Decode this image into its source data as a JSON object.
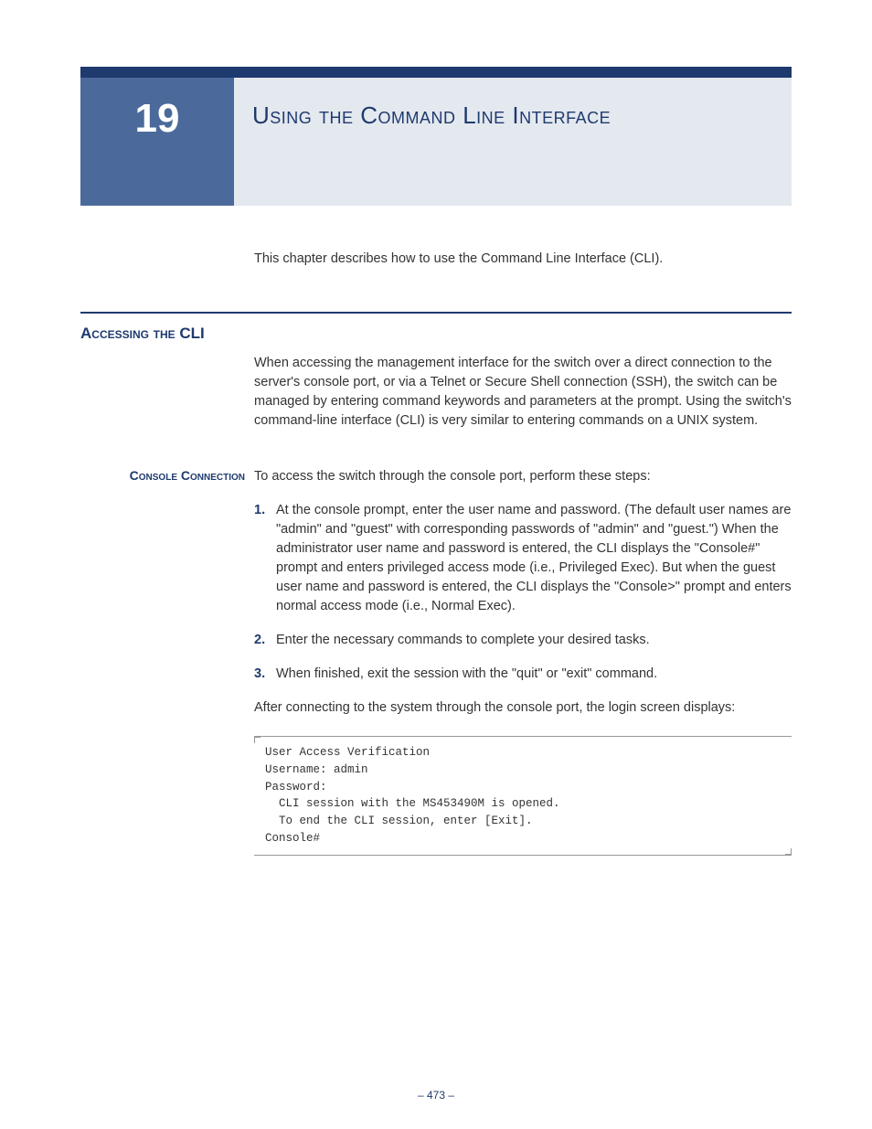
{
  "chapter": {
    "number": "19",
    "title": "Using the Command Line Interface"
  },
  "intro": "This chapter describes how to use the Command Line Interface (CLI).",
  "section1": {
    "heading": "Accessing the CLI",
    "body": "When accessing the management interface for the switch over a direct connection to the server's console port, or via a Telnet or Secure Shell connection (SSH), the switch can be managed by entering command keywords and parameters at the prompt. Using the switch's command-line interface (CLI) is very similar to entering commands on a UNIX system."
  },
  "subsection1": {
    "label": "Console Connection",
    "intro": "To access the switch through the console port, perform these steps:",
    "steps": [
      "At the console prompt, enter the user name and password. (The default user names are \"admin\" and \"guest\" with corresponding passwords of \"admin\" and \"guest.\") When the administrator user name and password is entered, the CLI displays the \"Console#\" prompt and enters privileged access mode (i.e., Privileged Exec). But when the guest user name and password is entered, the CLI displays the \"Console>\" prompt and enters normal access mode (i.e., Normal Exec).",
      "Enter the necessary commands to complete your desired tasks.",
      "When finished, exit the session with the \"quit\" or \"exit\" command."
    ],
    "after_steps": "After connecting to the system through the console port, the login screen displays:",
    "code": "User Access Verification\nUsername: admin\nPassword:\n  CLI session with the MS453490M is opened.\n  To end the CLI session, enter [Exit].\nConsole#"
  },
  "page_number": "– 473 –"
}
